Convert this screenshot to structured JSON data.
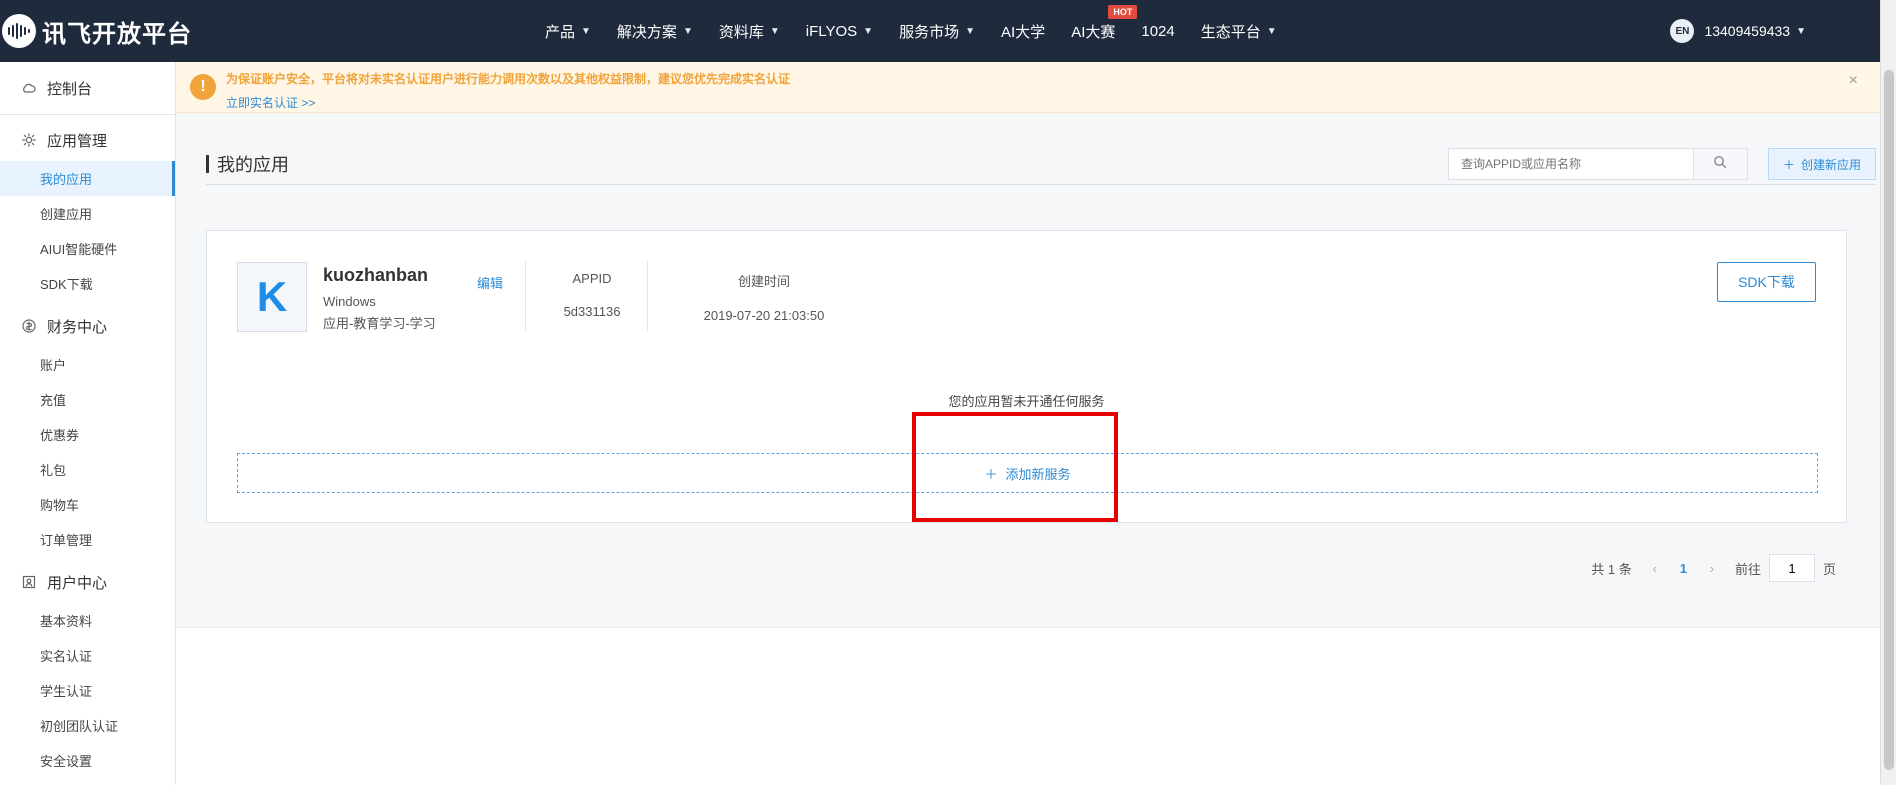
{
  "brand": {
    "name": "讯飞开放平台"
  },
  "topnav": {
    "items": [
      {
        "label": "产品",
        "caret": true
      },
      {
        "label": "解决方案",
        "caret": true
      },
      {
        "label": "资料库",
        "caret": true
      },
      {
        "label": "iFLYOS",
        "caret": true
      },
      {
        "label": "服务市场",
        "caret": true
      },
      {
        "label": "AI大学",
        "caret": false
      },
      {
        "label": "AI大赛",
        "caret": false,
        "badge": "HOT"
      },
      {
        "label": "1024",
        "caret": false
      },
      {
        "label": "生态平台",
        "caret": true
      }
    ],
    "lang": "EN",
    "user": "13409459433"
  },
  "sidebar": {
    "top": {
      "label": "控制台"
    },
    "groups": [
      {
        "title": "应用管理",
        "items": [
          "我的应用",
          "创建应用",
          "AIUI智能硬件",
          "SDK下载"
        ]
      },
      {
        "title": "财务中心",
        "items": [
          "账户",
          "充值",
          "优惠券",
          "礼包",
          "购物车",
          "订单管理"
        ]
      },
      {
        "title": "用户中心",
        "items": [
          "基本资料",
          "实名认证",
          "学生认证",
          "初创团队认证",
          "安全设置"
        ]
      }
    ],
    "active": "我的应用"
  },
  "notice": {
    "text": "为保证账户安全，平台将对未实名认证用户进行能力调用次数以及其他权益限制，建议您优先完成实名认证",
    "link": "立即实名认证 >>",
    "close": "×"
  },
  "page": {
    "title": "我的应用",
    "search_placeholder": "查询APPID或应用名称",
    "create_label": "创建新应用"
  },
  "app": {
    "avatar": "K",
    "name": "kuozhanban",
    "platform": "Windows",
    "category": "应用-教育学习-学习",
    "edit": "编辑",
    "appid_label": "APPID",
    "appid": "5d331136",
    "created_label": "创建时间",
    "created": "2019-07-20 21:03:50",
    "sdk": "SDK下载",
    "no_service": "您的应用暂未开通任何服务",
    "add_service": "添加新服务"
  },
  "pagination": {
    "total": "共 1 条",
    "current": "1",
    "goto_prefix": "前往",
    "goto_value": "1",
    "goto_suffix": "页"
  },
  "colors": {
    "nav_bg": "#1f2a3c",
    "accent": "#2d8bd6",
    "notice_bg": "#fff6e6",
    "notice_icon": "#f0a43b",
    "highlight": "#e60000"
  }
}
